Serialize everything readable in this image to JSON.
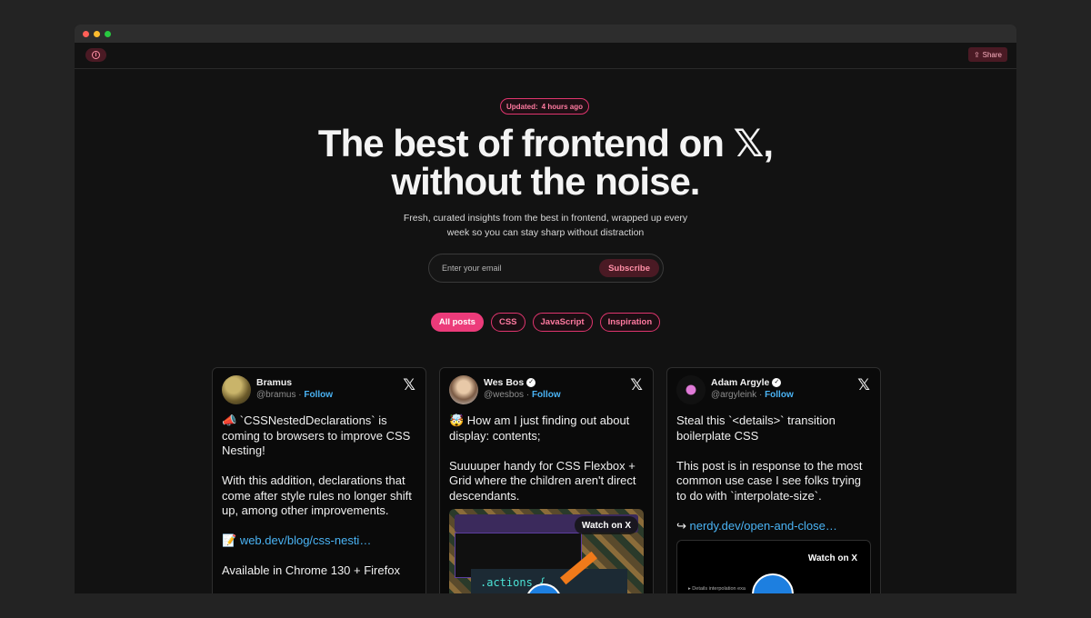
{
  "topbar": {
    "share_label": "Share",
    "info_icon": "info-icon",
    "share_icon": "share-icon"
  },
  "hero": {
    "updated_label": "Updated:",
    "updated_value": "4 hours ago",
    "headline_line1": "The best of frontend on ",
    "headline_x": "𝕏",
    "headline_comma": ",",
    "headline_line2": "without the noise.",
    "subtitle": "Fresh, curated insights from the best in frontend, wrapped up every week so you can stay sharp without distraction"
  },
  "subscribe": {
    "placeholder": "Enter your email",
    "button_label": "Subscribe"
  },
  "filters": [
    {
      "label": "All posts",
      "active": true
    },
    {
      "label": "CSS",
      "active": false
    },
    {
      "label": "JavaScript",
      "active": false
    },
    {
      "label": "Inspiration",
      "active": false
    }
  ],
  "colors": {
    "accent": "#ec3b7a",
    "link": "#4ab3f4",
    "background": "#121212"
  },
  "posts": [
    {
      "name": "Bramus",
      "handle": "@bramus",
      "verified": false,
      "follow_label": "Follow",
      "text_before_link": "📣 `CSSNestedDeclarations` is coming to browsers to improve CSS Nesting!\n\nWith this addition, declarations that come after style rules no longer shift up, among other improvements.\n\n📝 ",
      "link": "web.dev/blog/css-nesti…",
      "text_after_link": "\n\nAvailable in Chrome 130 + Firefox"
    },
    {
      "name": "Wes Bos",
      "handle": "@wesbos",
      "verified": true,
      "follow_label": "Follow",
      "text": "🤯 How am I just finding out about display: contents;\n\nSuuuuper handy for CSS Flexbox + Grid where the children aren't direct descendants.",
      "media_watch_label": "Watch on X",
      "media_code": ".actions {"
    },
    {
      "name": "Adam Argyle",
      "handle": "@argyleink",
      "verified": true,
      "follow_label": "Follow",
      "text": "Steal this `<details>` transition boilerplate CSS\n\nThis post is in response to the most common use case I see folks trying to do with `interpolate-size`.\n\n↪ ",
      "link": "nerdy.dev/open-and-close…",
      "media_watch_label": "Watch on X",
      "media_caption": "▸ Details interpolation exa"
    }
  ]
}
